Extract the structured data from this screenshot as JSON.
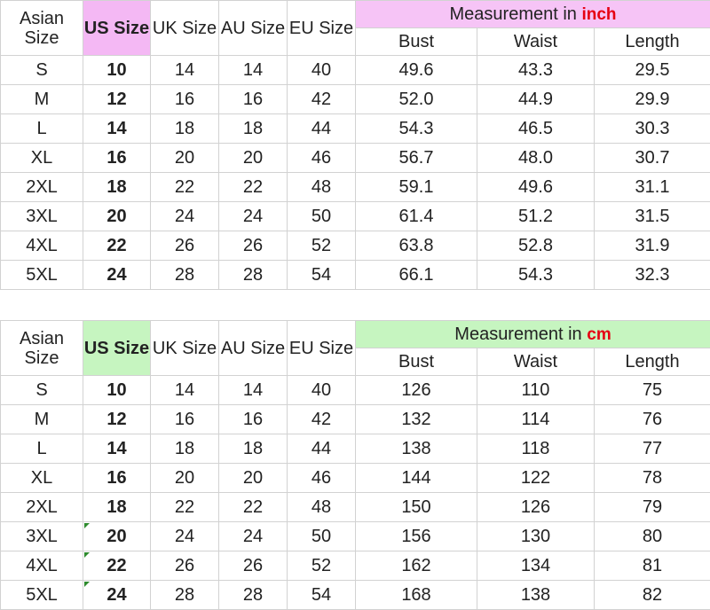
{
  "headers": {
    "asian_size": "Asian Size",
    "us_size": "US Size",
    "uk_size": "UK Size",
    "au_size": "AU Size",
    "eu_size": "EU Size",
    "bust": "Bust",
    "waist": "Waist",
    "length": "Length"
  },
  "colors": {
    "inch_us_bg": "#f4b8f4",
    "inch_meas_bg": "#f6c4f6",
    "cm_us_bg": "#c6f5c0",
    "cm_meas_bg": "#c6f5c0",
    "unit_color": "#e60012"
  },
  "inch_table": {
    "measurement_label": "Measurement in",
    "unit": "inch",
    "rows": [
      {
        "asian": "S",
        "us": "10",
        "uk": "14",
        "au": "14",
        "eu": "40",
        "bust": "49.6",
        "waist": "43.3",
        "length": "29.5"
      },
      {
        "asian": "M",
        "us": "12",
        "uk": "16",
        "au": "16",
        "eu": "42",
        "bust": "52.0",
        "waist": "44.9",
        "length": "29.9"
      },
      {
        "asian": "L",
        "us": "14",
        "uk": "18",
        "au": "18",
        "eu": "44",
        "bust": "54.3",
        "waist": "46.5",
        "length": "30.3"
      },
      {
        "asian": "XL",
        "us": "16",
        "uk": "20",
        "au": "20",
        "eu": "46",
        "bust": "56.7",
        "waist": "48.0",
        "length": "30.7"
      },
      {
        "asian": "2XL",
        "us": "18",
        "uk": "22",
        "au": "22",
        "eu": "48",
        "bust": "59.1",
        "waist": "49.6",
        "length": "31.1"
      },
      {
        "asian": "3XL",
        "us": "20",
        "uk": "24",
        "au": "24",
        "eu": "50",
        "bust": "61.4",
        "waist": "51.2",
        "length": "31.5"
      },
      {
        "asian": "4XL",
        "us": "22",
        "uk": "26",
        "au": "26",
        "eu": "52",
        "bust": "63.8",
        "waist": "52.8",
        "length": "31.9"
      },
      {
        "asian": "5XL",
        "us": "24",
        "uk": "28",
        "au": "28",
        "eu": "54",
        "bust": "66.1",
        "waist": "54.3",
        "length": "32.3"
      }
    ]
  },
  "cm_table": {
    "measurement_label": "Measurement in",
    "unit": "cm",
    "rows": [
      {
        "asian": "S",
        "us": "10",
        "uk": "14",
        "au": "14",
        "eu": "40",
        "bust": "126",
        "waist": "110",
        "length": "75"
      },
      {
        "asian": "M",
        "us": "12",
        "uk": "16",
        "au": "16",
        "eu": "42",
        "bust": "132",
        "waist": "114",
        "length": "76"
      },
      {
        "asian": "L",
        "us": "14",
        "uk": "18",
        "au": "18",
        "eu": "44",
        "bust": "138",
        "waist": "118",
        "length": "77"
      },
      {
        "asian": "XL",
        "us": "16",
        "uk": "20",
        "au": "20",
        "eu": "46",
        "bust": "144",
        "waist": "122",
        "length": "78"
      },
      {
        "asian": "2XL",
        "us": "18",
        "uk": "22",
        "au": "22",
        "eu": "48",
        "bust": "150",
        "waist": "126",
        "length": "79"
      },
      {
        "asian": "3XL",
        "us": "20",
        "uk": "24",
        "au": "24",
        "eu": "50",
        "bust": "156",
        "waist": "130",
        "length": "80"
      },
      {
        "asian": "4XL",
        "us": "22",
        "uk": "26",
        "au": "26",
        "eu": "52",
        "bust": "162",
        "waist": "134",
        "length": "81"
      },
      {
        "asian": "5XL",
        "us": "24",
        "uk": "28",
        "au": "28",
        "eu": "54",
        "bust": "168",
        "waist": "138",
        "length": "82"
      }
    ]
  }
}
